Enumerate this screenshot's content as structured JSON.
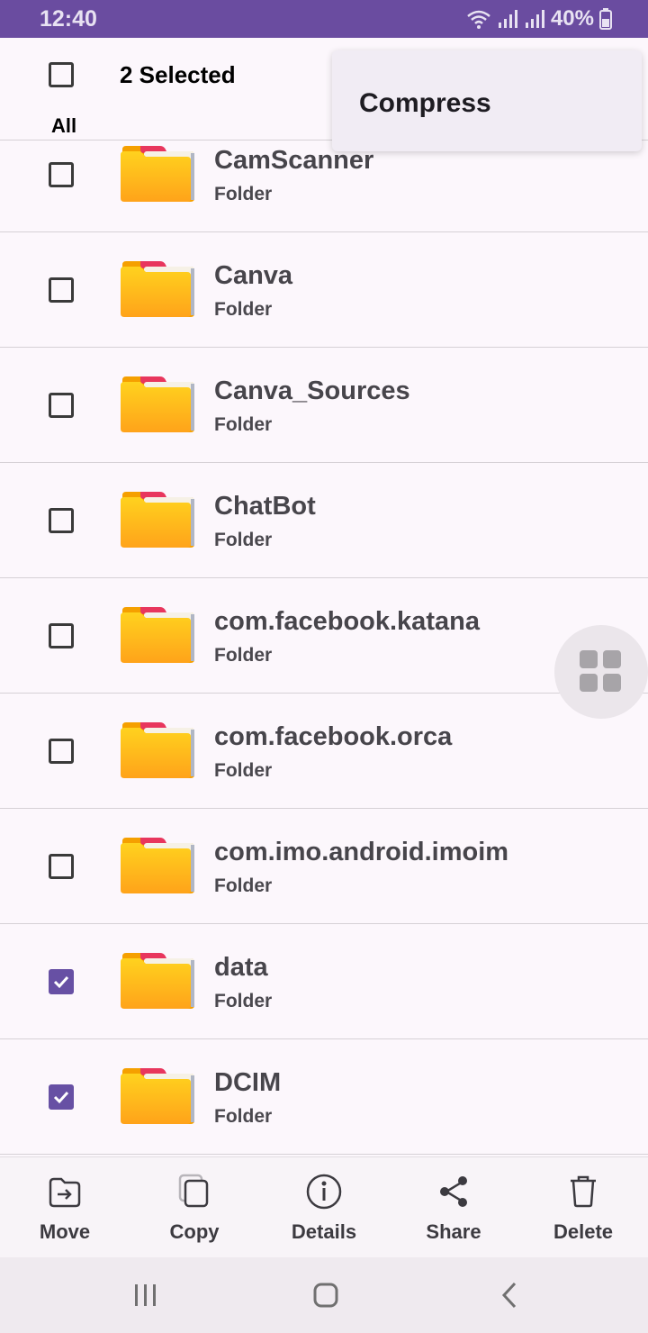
{
  "status_bar": {
    "time": "12:40",
    "battery": "40%"
  },
  "header": {
    "title": "2 Selected",
    "select_all_label": "All"
  },
  "popup_menu": {
    "items": [
      "Compress"
    ]
  },
  "files": [
    {
      "name": "CamScanner",
      "type": "Folder",
      "checked": false
    },
    {
      "name": "Canva",
      "type": "Folder",
      "checked": false
    },
    {
      "name": "Canva_Sources",
      "type": "Folder",
      "checked": false
    },
    {
      "name": "ChatBot",
      "type": "Folder",
      "checked": false
    },
    {
      "name": "com.facebook.katana",
      "type": "Folder",
      "checked": false
    },
    {
      "name": "com.facebook.orca",
      "type": "Folder",
      "checked": false
    },
    {
      "name": "com.imo.android.imoim",
      "type": "Folder",
      "checked": false
    },
    {
      "name": "data",
      "type": "Folder",
      "checked": true
    },
    {
      "name": "DCIM",
      "type": "Folder",
      "checked": true
    }
  ],
  "toolbar": {
    "move": "Move",
    "copy": "Copy",
    "details": "Details",
    "share": "Share",
    "delete": "Delete"
  },
  "colors": {
    "status_bar": "#6a4ca0",
    "accent": "#6750a4",
    "folder": "#ffc107"
  },
  "icons": [
    "wifi-icon",
    "signal-icon",
    "battery-icon",
    "folder-icon",
    "grid-view-icon",
    "move-icon",
    "copy-icon",
    "info-icon",
    "share-icon",
    "trash-icon",
    "recents-icon",
    "home-icon",
    "back-icon"
  ]
}
